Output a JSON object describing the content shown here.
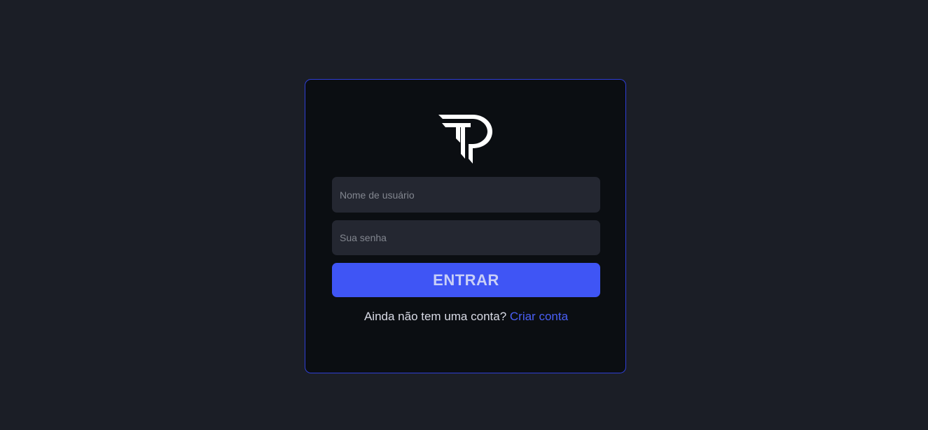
{
  "login": {
    "logo_icon": "tp-logo-icon",
    "username_placeholder": "Nome de usuário",
    "password_placeholder": "Sua senha",
    "submit_label": "ENTRAR",
    "signup_prompt": "Ainda não tem uma conta?",
    "signup_link": "Criar conta"
  },
  "colors": {
    "background": "#1b1e26",
    "card": "#0b0e12",
    "card_border": "#2f3fd6",
    "input": "#242731",
    "accent": "#3f55f5",
    "link": "#4a5ff5"
  }
}
